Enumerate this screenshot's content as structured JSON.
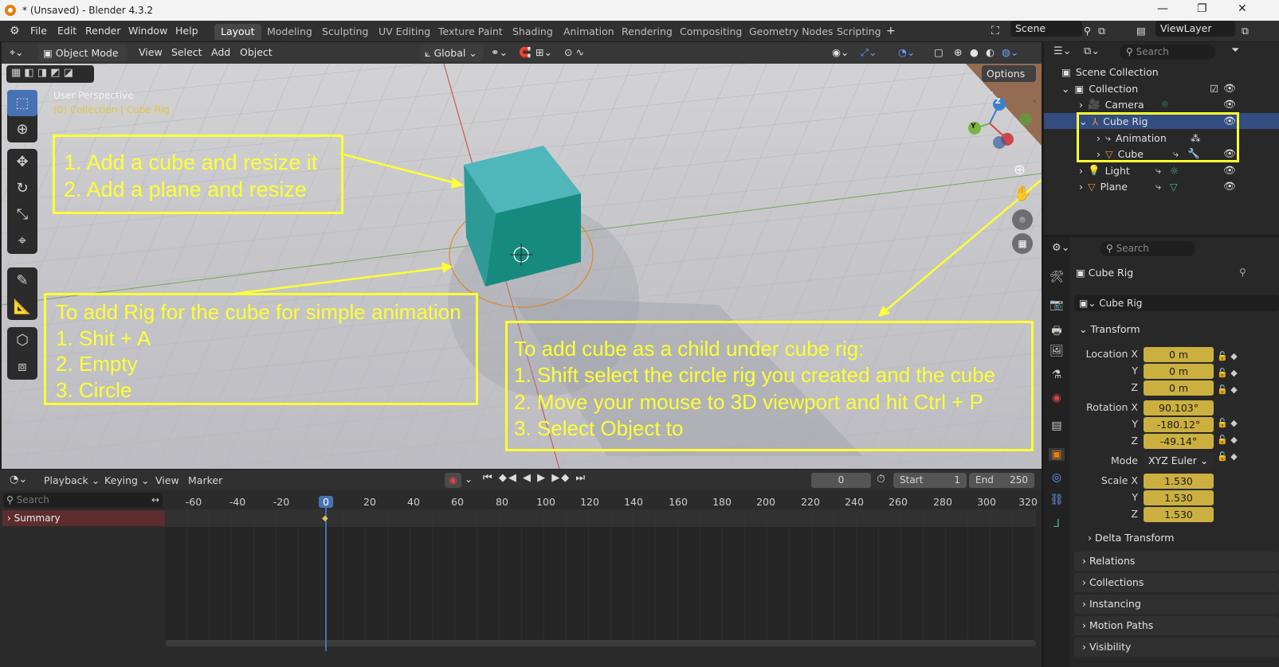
{
  "window": {
    "title": "* (Unsaved) - Blender 4.3.2",
    "minimize": "—",
    "maximize": "❐",
    "close": "✕"
  },
  "menus": [
    "File",
    "Edit",
    "Render",
    "Window",
    "Help"
  ],
  "workspaces": [
    "Layout",
    "Modeling",
    "Sculpting",
    "UV Editing",
    "Texture Paint",
    "Shading",
    "Animation",
    "Rendering",
    "Compositing",
    "Geometry Nodes",
    "Scripting"
  ],
  "workspace_add": "+",
  "scene": "Scene",
  "view_layer": "ViewLayer",
  "viewport_header": {
    "mode": "Object Mode",
    "menus": [
      "View",
      "Select",
      "Add",
      "Object"
    ],
    "transform_orientation": "Global",
    "options": "Options"
  },
  "viewport": {
    "perspective": "User Perspective",
    "collection_info": "(0) Collection | Cube Rig",
    "gizmo": {
      "z": "Z",
      "y": "Y"
    }
  },
  "annotations": {
    "box1": [
      "1. Add a cube and resize it",
      "2. Add a plane and resize"
    ],
    "box2": [
      "To add Rig for the cube for simple animation",
      "1. Shit + A",
      "2. Empty",
      "3. Circle"
    ],
    "box3": [
      "To add cube as a child under cube rig:",
      "1. Shift select the circle rig you created and the cube",
      "2. Move your mouse to 3D viewport and hit Ctrl + P",
      "3. Select Object to"
    ],
    "color": "#ffff33"
  },
  "timeline": {
    "menus": [
      "Playback",
      "Keying",
      "View",
      "Marker"
    ],
    "current_frame": "0",
    "start_label": "Start",
    "start": "1",
    "end_label": "End",
    "end": "250",
    "search_placeholder": "Search",
    "summary": "Summary",
    "ticks": [
      "-60",
      "-40",
      "-20",
      "0",
      "20",
      "40",
      "60",
      "80",
      "100",
      "120",
      "140",
      "160",
      "180",
      "200",
      "220",
      "240",
      "260",
      "280",
      "300",
      "320"
    ]
  },
  "outliner": {
    "search_placeholder": "Search",
    "items": [
      {
        "label": "Scene Collection",
        "depth": 0
      },
      {
        "label": "Collection",
        "depth": 1
      },
      {
        "label": "Camera",
        "depth": 2
      },
      {
        "label": "Cube Rig",
        "depth": 2,
        "selected": true
      },
      {
        "label": "Animation",
        "depth": 3
      },
      {
        "label": "Cube",
        "depth": 3
      },
      {
        "label": "Light",
        "depth": 2
      },
      {
        "label": "Plane",
        "depth": 2
      }
    ]
  },
  "properties": {
    "search_placeholder": "Search",
    "object_name": "Cube Rig",
    "object_field": "Cube Rig",
    "transform_header": "Transform",
    "location_label": "Location X",
    "location": [
      "0 m",
      "0 m",
      "0 m"
    ],
    "rotation_label": "Rotation X",
    "rotation": [
      "90.103°",
      "-180.12°",
      "-49.14°"
    ],
    "mode_label": "Mode",
    "mode": "XYZ Euler",
    "scale_label": "Scale X",
    "scale": [
      "1.530",
      "1.530",
      "1.530"
    ],
    "axis_y": "Y",
    "axis_z": "Z",
    "delta_transform": "Delta Transform",
    "panels": [
      "Relations",
      "Collections",
      "Instancing",
      "Motion Paths",
      "Visibility"
    ]
  }
}
